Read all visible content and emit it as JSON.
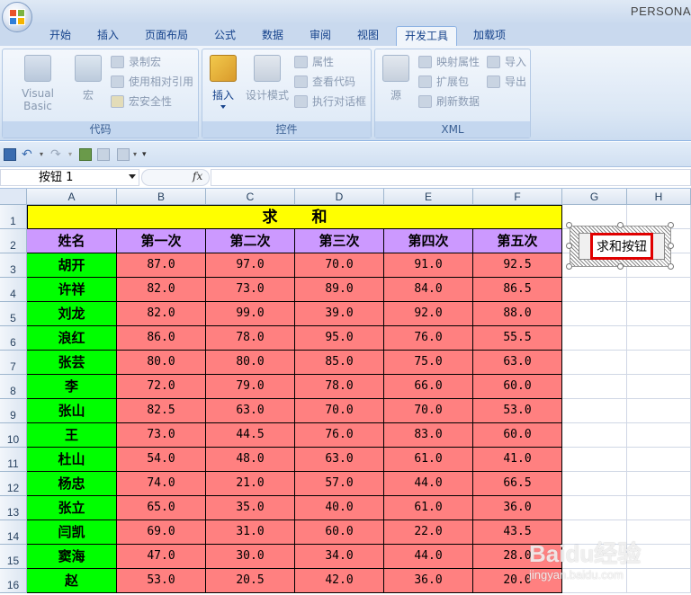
{
  "window": {
    "title": "PERSONA"
  },
  "tabs": [
    {
      "label": "开始"
    },
    {
      "label": "插入"
    },
    {
      "label": "页面布局"
    },
    {
      "label": "公式"
    },
    {
      "label": "数据"
    },
    {
      "label": "审阅"
    },
    {
      "label": "视图"
    },
    {
      "label": "开发工具"
    },
    {
      "label": "加载项"
    }
  ],
  "active_tab": "开发工具",
  "ribbon": {
    "code": {
      "label": "代码",
      "visual_basic": "Visual Basic",
      "macros": "宏",
      "record_macro": "录制宏",
      "use_relative": "使用相对引用",
      "macro_security": "宏安全性"
    },
    "controls": {
      "label": "控件",
      "insert": "插入",
      "design_mode": "设计模式",
      "properties": "属性",
      "view_code": "查看代码",
      "run_dialog": "执行对话框"
    },
    "xml": {
      "label": "XML",
      "source": "源",
      "map_properties": "映射属性",
      "expansion_packs": "扩展包",
      "refresh_data": "刷新数据",
      "import": "导入",
      "export": "导出"
    }
  },
  "formula_bar": {
    "name_box": "按钮 1",
    "fx": "fx",
    "formula": ""
  },
  "columns": [
    "A",
    "B",
    "C",
    "D",
    "E",
    "F",
    "G",
    "H"
  ],
  "rows": [
    "1",
    "2",
    "3",
    "4",
    "5",
    "6",
    "7",
    "8",
    "9",
    "10",
    "11",
    "12",
    "13",
    "14",
    "15",
    "16"
  ],
  "sheet": {
    "title": "求和",
    "headers": [
      "姓名",
      "第一次",
      "第二次",
      "第三次",
      "第四次",
      "第五次"
    ],
    "records": [
      {
        "name": "胡开",
        "scores": [
          "87.0",
          "97.0",
          "70.0",
          "91.0",
          "92.5"
        ]
      },
      {
        "name": "许祥",
        "scores": [
          "82.0",
          "73.0",
          "89.0",
          "84.0",
          "86.5"
        ]
      },
      {
        "name": "刘龙",
        "scores": [
          "82.0",
          "99.0",
          "39.0",
          "92.0",
          "88.0"
        ]
      },
      {
        "name": "浪红",
        "scores": [
          "86.0",
          "78.0",
          "95.0",
          "76.0",
          "55.5"
        ]
      },
      {
        "name": "张芸",
        "scores": [
          "80.0",
          "80.0",
          "85.0",
          "75.0",
          "63.0"
        ]
      },
      {
        "name": "李",
        "scores": [
          "72.0",
          "79.0",
          "78.0",
          "66.0",
          "60.0"
        ]
      },
      {
        "name": "张山",
        "scores": [
          "82.5",
          "63.0",
          "70.0",
          "70.0",
          "53.0"
        ]
      },
      {
        "name": "王",
        "scores": [
          "73.0",
          "44.5",
          "76.0",
          "83.0",
          "60.0"
        ]
      },
      {
        "name": "杜山",
        "scores": [
          "54.0",
          "48.0",
          "63.0",
          "61.0",
          "41.0"
        ]
      },
      {
        "name": "杨忠",
        "scores": [
          "74.0",
          "21.0",
          "57.0",
          "44.0",
          "66.5"
        ]
      },
      {
        "name": "张立",
        "scores": [
          "65.0",
          "35.0",
          "40.0",
          "61.0",
          "36.0"
        ]
      },
      {
        "name": "闫凯",
        "scores": [
          "69.0",
          "31.0",
          "60.0",
          "22.0",
          "43.5"
        ]
      },
      {
        "name": "窦海",
        "scores": [
          "47.0",
          "30.0",
          "34.0",
          "44.0",
          "28.0"
        ]
      },
      {
        "name": "赵",
        "scores": [
          "53.0",
          "20.5",
          "42.0",
          "36.0",
          "20.0"
        ]
      }
    ]
  },
  "form_button": {
    "label": "求和按钮"
  },
  "watermark": {
    "main": "Baidu经验",
    "sub": "jingyan.baidu.com"
  }
}
